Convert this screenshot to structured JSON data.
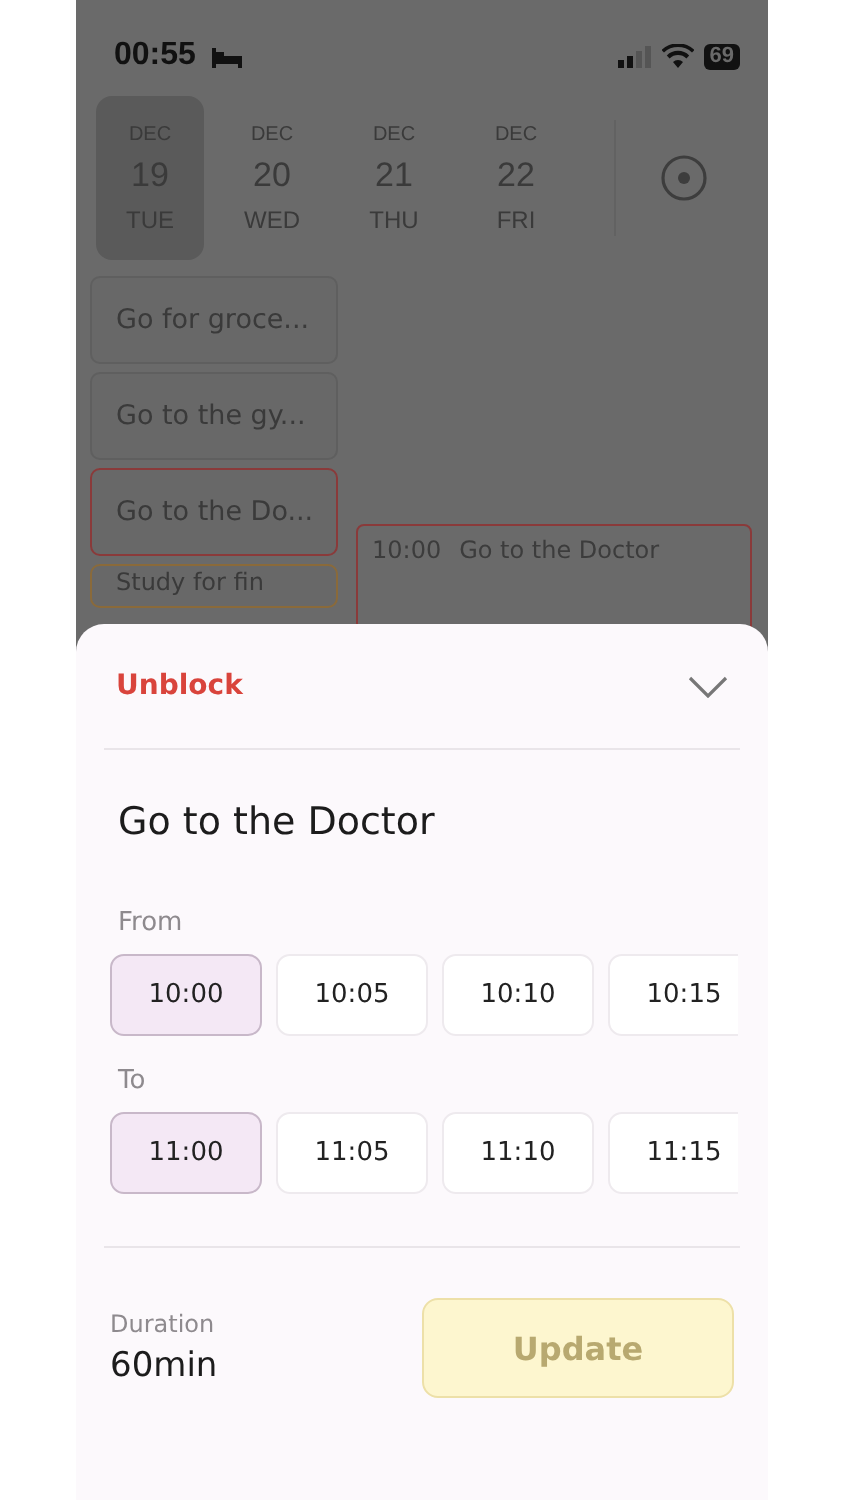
{
  "status_bar": {
    "time": "00:55",
    "battery": "69"
  },
  "dates": [
    {
      "month": "DEC",
      "day": "19",
      "weekday": "TUE",
      "selected": true
    },
    {
      "month": "DEC",
      "day": "20",
      "weekday": "WED",
      "selected": false
    },
    {
      "month": "DEC",
      "day": "21",
      "weekday": "THU",
      "selected": false
    },
    {
      "month": "DEC",
      "day": "22",
      "weekday": "FRI",
      "selected": false
    }
  ],
  "tasks": [
    {
      "title": "Go for groce...",
      "color": "#5f5f5f"
    },
    {
      "title": "Go to the gy...",
      "color": "#5f5f5f"
    },
    {
      "title": "Go to the Do...",
      "color": "#8a3a3a"
    },
    {
      "title": "Study for fin",
      "color": "#8a6a3a"
    }
  ],
  "event": {
    "time": "10:00",
    "title": "Go to the Doctor",
    "color": "#8a3a3a"
  },
  "sheet": {
    "action": "Unblock",
    "title": "Go to the Doctor",
    "from_label": "From",
    "from_slots": [
      {
        "label": "10:00",
        "selected": true
      },
      {
        "label": "10:05",
        "selected": false
      },
      {
        "label": "10:10",
        "selected": false
      },
      {
        "label": "10:15",
        "selected": false
      }
    ],
    "to_label": "To",
    "to_slots": [
      {
        "label": "11:00",
        "selected": true
      },
      {
        "label": "11:05",
        "selected": false
      },
      {
        "label": "11:10",
        "selected": false
      },
      {
        "label": "11:15",
        "selected": false
      }
    ],
    "duration_label": "Duration",
    "duration": "60min",
    "button": {
      "label": "Update",
      "disabled": true
    }
  }
}
